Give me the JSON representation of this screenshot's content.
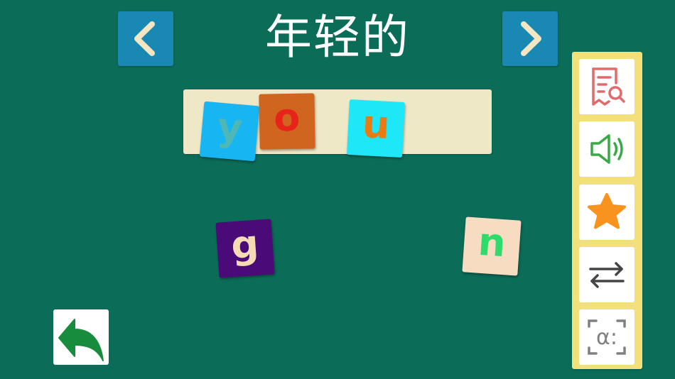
{
  "title": "年轻的",
  "letters": [
    {
      "char": "y",
      "bg": "#17b6f3",
      "fg": "#4fb7b6"
    },
    {
      "char": "o",
      "bg": "#d0651f",
      "fg": "#e8231a"
    },
    {
      "char": "u",
      "bg": "#1ee7f7",
      "fg": "#e87b12"
    },
    {
      "char": "g",
      "bg": "#4a0a78",
      "fg": "#f5dbb5"
    },
    {
      "char": "n",
      "bg": "#f8dcc2",
      "fg": "#2ddc6b"
    }
  ],
  "colors": {
    "background": "#0b6c58",
    "nav_button": "#1989b4",
    "tray": "#efe8c7",
    "side_panel": "#f2e07a",
    "search_icon": "#e06b6b",
    "speaker_icon": "#3aa847",
    "star_icon": "#f7931e",
    "swap_icon": "#444444",
    "phonetic_icon": "#808080",
    "back_icon": "#168c3c"
  },
  "icons": {
    "prev": "chevron-left-icon",
    "next": "chevron-right-icon",
    "tools": [
      "document-search-icon",
      "speaker-icon",
      "star-icon",
      "swap-arrows-icon",
      "phonetic-symbol-icon"
    ],
    "back": "back-arrow-icon"
  },
  "phonetic_glyph": "α:"
}
